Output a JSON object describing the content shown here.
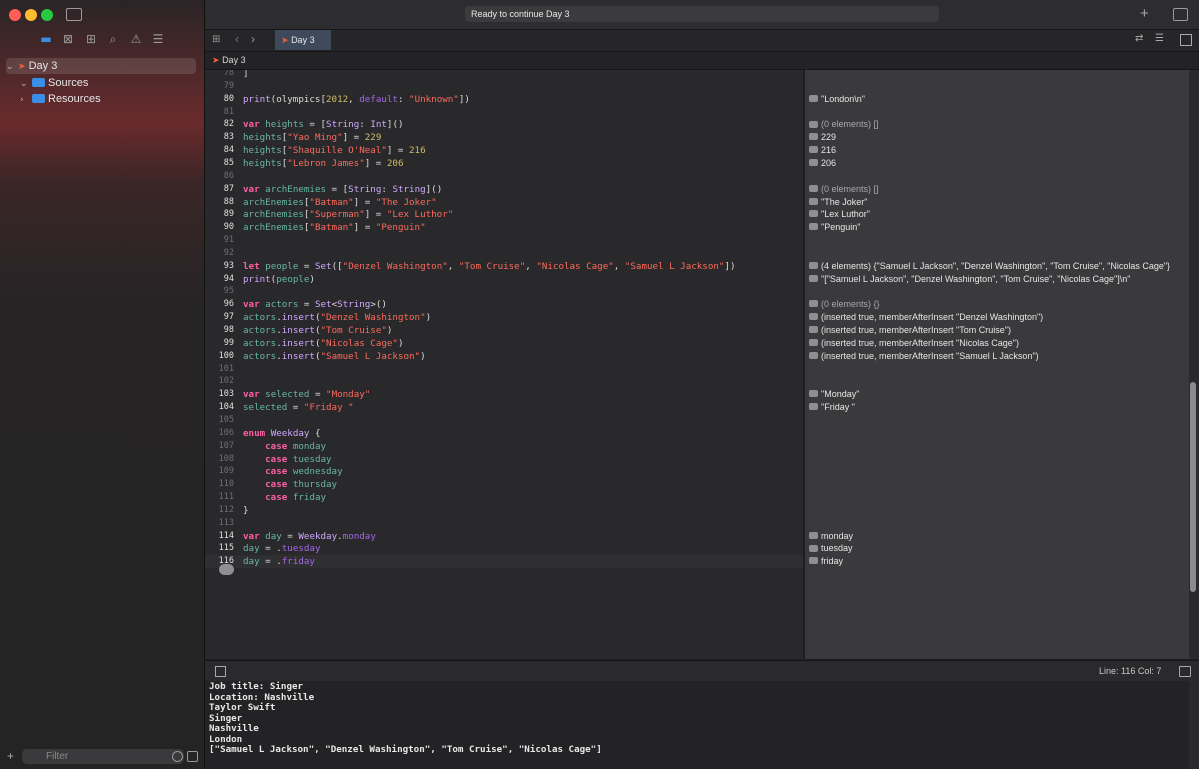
{
  "window": {
    "traffic_colors": [
      "#ff5f57",
      "#febc2e",
      "#28c840"
    ],
    "status": "Ready to continue Day 3"
  },
  "tab": {
    "label": "Day 3"
  },
  "breadcrumb": {
    "label": "Day 3"
  },
  "sidebar": {
    "project": "Day 3",
    "items": [
      "Sources",
      "Resources"
    ],
    "filter_placeholder": "Filter"
  },
  "code": [
    {
      "n": "78",
      "t": "]",
      "bold_n": false
    },
    {
      "n": "79",
      "t": "",
      "bold_n": false
    },
    {
      "n": "80",
      "t": "print(olympics[2012, default: \"Unknown\"])",
      "bold_n": true
    },
    {
      "n": "81",
      "t": "",
      "bold_n": false
    },
    {
      "n": "82",
      "t": "var heights = [String: Int]()",
      "bold_n": true
    },
    {
      "n": "83",
      "t": "heights[\"Yao Ming\"] = 229",
      "bold_n": true
    },
    {
      "n": "84",
      "t": "heights[\"Shaquille O'Neal\"] = 216",
      "bold_n": true
    },
    {
      "n": "85",
      "t": "heights[\"Lebron James\"] = 206",
      "bold_n": true
    },
    {
      "n": "86",
      "t": "",
      "bold_n": false
    },
    {
      "n": "87",
      "t": "var archEnemies = [String: String]()",
      "bold_n": true
    },
    {
      "n": "88",
      "t": "archEnemies[\"Batman\"] = \"The Joker\"",
      "bold_n": true
    },
    {
      "n": "89",
      "t": "archEnemies[\"Superman\"] = \"Lex Luthor\"",
      "bold_n": true
    },
    {
      "n": "90",
      "t": "archEnemies[\"Batman\"] = \"Penguin\"",
      "bold_n": true
    },
    {
      "n": "91",
      "t": "",
      "bold_n": false
    },
    {
      "n": "92",
      "t": "",
      "bold_n": false
    },
    {
      "n": "93",
      "t": "let people = Set([\"Denzel Washington\", \"Tom Cruise\", \"Nicolas Cage\", \"Samuel L Jackson\"])",
      "bold_n": true
    },
    {
      "n": "94",
      "t": "print(people)",
      "bold_n": true
    },
    {
      "n": "95",
      "t": "",
      "bold_n": false
    },
    {
      "n": "96",
      "t": "var actors = Set<String>()",
      "bold_n": true
    },
    {
      "n": "97",
      "t": "actors.insert(\"Denzel Washington\")",
      "bold_n": true
    },
    {
      "n": "98",
      "t": "actors.insert(\"Tom Cruise\")",
      "bold_n": true
    },
    {
      "n": "99",
      "t": "actors.insert(\"Nicolas Cage\")",
      "bold_n": true
    },
    {
      "n": "100",
      "t": "actors.insert(\"Samuel L Jackson\")",
      "bold_n": true
    },
    {
      "n": "101",
      "t": "",
      "bold_n": false
    },
    {
      "n": "102",
      "t": "",
      "bold_n": false
    },
    {
      "n": "103",
      "t": "var selected = \"Monday\"",
      "bold_n": true
    },
    {
      "n": "104",
      "t": "selected = \"Friday \"",
      "bold_n": true
    },
    {
      "n": "105",
      "t": "",
      "bold_n": false
    },
    {
      "n": "106",
      "t": "enum Weekday {",
      "bold_n": false
    },
    {
      "n": "107",
      "t": "    case monday",
      "bold_n": false
    },
    {
      "n": "108",
      "t": "    case tuesday",
      "bold_n": false
    },
    {
      "n": "109",
      "t": "    case wednesday",
      "bold_n": false
    },
    {
      "n": "110",
      "t": "    case thursday",
      "bold_n": false
    },
    {
      "n": "111",
      "t": "    case friday",
      "bold_n": false
    },
    {
      "n": "112",
      "t": "}",
      "bold_n": false
    },
    {
      "n": "113",
      "t": "",
      "bold_n": false
    },
    {
      "n": "114",
      "t": "var day = Weekday.monday",
      "bold_n": true
    },
    {
      "n": "115",
      "t": "day = .tuesday",
      "bold_n": true
    },
    {
      "n": "116",
      "t": "day = .friday",
      "bold_n": true
    }
  ],
  "results": [
    {
      "line": 2,
      "text": "\"London\\n\""
    },
    {
      "line": 4,
      "text": "(0 elements) []",
      "muted": true
    },
    {
      "line": 5,
      "text": "229"
    },
    {
      "line": 6,
      "text": "216"
    },
    {
      "line": 7,
      "text": "206"
    },
    {
      "line": 9,
      "text": "(0 elements) []",
      "muted": true
    },
    {
      "line": 10,
      "text": "\"The Joker\""
    },
    {
      "line": 11,
      "text": "\"Lex Luthor\""
    },
    {
      "line": 12,
      "text": "\"Penguin\""
    },
    {
      "line": 15,
      "text": "(4 elements) {\"Samuel L Jackson\", \"Denzel Washington\", \"Tom Cruise\", \"Nicolas Cage\"}"
    },
    {
      "line": 16,
      "text": "\"[\"Samuel L Jackson\", \"Denzel Washington\", \"Tom Cruise\", \"Nicolas Cage\"]\\n\""
    },
    {
      "line": 18,
      "text": "(0 elements) {}",
      "muted": true
    },
    {
      "line": 19,
      "text": "(inserted true, memberAfterInsert \"Denzel Washington\")"
    },
    {
      "line": 20,
      "text": "(inserted true, memberAfterInsert \"Tom Cruise\")"
    },
    {
      "line": 21,
      "text": "(inserted true, memberAfterInsert \"Nicolas Cage\")"
    },
    {
      "line": 22,
      "text": "(inserted true, memberAfterInsert \"Samuel L Jackson\")"
    },
    {
      "line": 25,
      "text": "\"Monday\""
    },
    {
      "line": 26,
      "text": "\"Friday \""
    },
    {
      "line": 36,
      "text": "monday"
    },
    {
      "line": 37,
      "text": "tuesday"
    },
    {
      "line": 38,
      "text": "friday"
    }
  ],
  "statusbar": {
    "position": "Line: 116  Col: 7"
  },
  "console": [
    "Job title: Singer",
    "Location: Nashville",
    "Taylor Swift",
    "Singer",
    "Nashville",
    "London",
    "[\"Samuel L Jackson\", \"Denzel Washington\", \"Tom Cruise\", \"Nicolas Cage\"]"
  ]
}
